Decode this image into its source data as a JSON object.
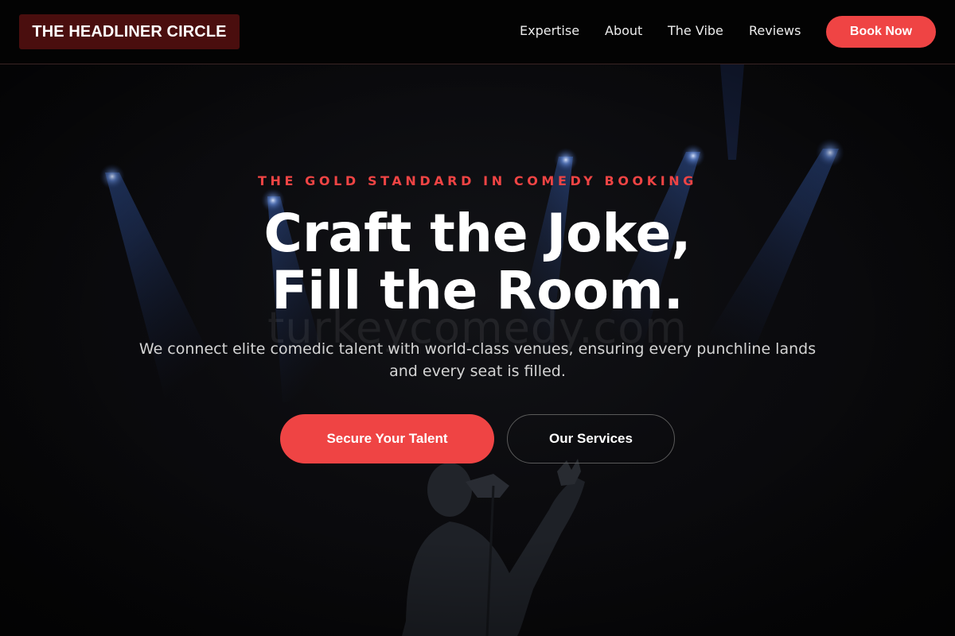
{
  "header": {
    "brand": "THE HEADLINER CIRCLE",
    "nav": [
      "Expertise",
      "About",
      "The Vibe",
      "Reviews"
    ],
    "cta": "Book Now"
  },
  "hero": {
    "eyebrow": "THE GOLD STANDARD IN COMEDY BOOKING",
    "headline_line1": "Craft the Joke,",
    "headline_line2": "Fill the Room.",
    "subtext": "We connect elite comedic talent with world-class venues, ensuring every punchline lands and every seat is filled.",
    "primary_cta": "Secure Your Talent",
    "secondary_cta": "Our Services",
    "watermark": "turkeycomedy.com"
  },
  "colors": {
    "accent": "#ef4444",
    "brand_bg": "#4a0e0e",
    "background": "#050505",
    "stage_light": "#3f6fd1"
  },
  "icons": [
    "stage-spotlight-icon",
    "comedian-silhouette-icon"
  ]
}
